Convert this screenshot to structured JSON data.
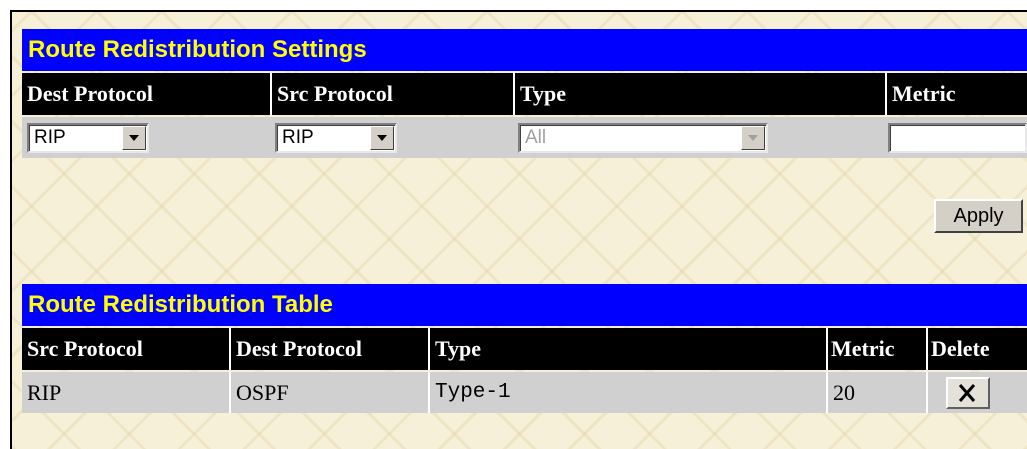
{
  "settings": {
    "title": "Route Redistribution Settings",
    "headers": {
      "dest_protocol": "Dest Protocol",
      "src_protocol": "Src Protocol",
      "type": "Type",
      "metric": "Metric"
    },
    "dest_protocol_value": "RIP",
    "src_protocol_value": "RIP",
    "type_value": "All",
    "metric_value": "",
    "apply_label": "Apply"
  },
  "table": {
    "title": "Route Redistribution Table",
    "headers": {
      "src_protocol": "Src Protocol",
      "dest_protocol": "Dest Protocol",
      "type": "Type",
      "metric": "Metric",
      "delete": "Delete"
    },
    "rows": [
      {
        "src_protocol": "RIP",
        "dest_protocol": "OSPF",
        "type": "Type-1",
        "metric": "20"
      }
    ]
  },
  "colors": {
    "title_bar": "#0000ff",
    "title_text": "#ffff00",
    "header_bg": "#000000",
    "row_bg": "#d0d0d0"
  },
  "icons": {
    "delete": "close-x-icon",
    "dropdown": "chevron-down-icon"
  }
}
